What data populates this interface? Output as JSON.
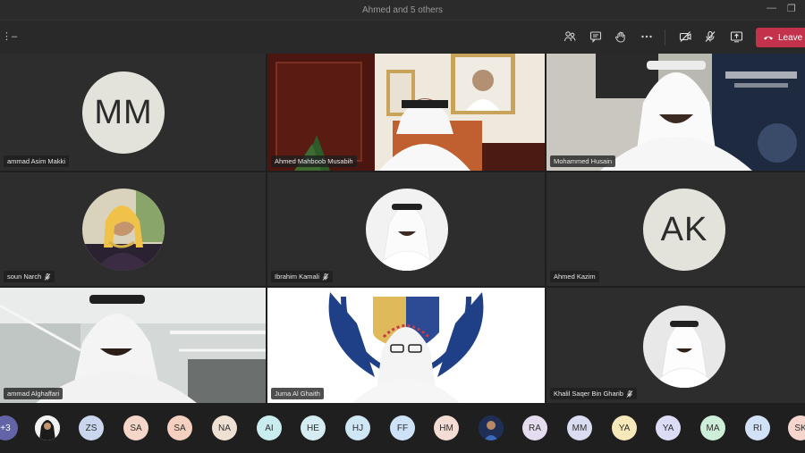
{
  "window": {
    "title": "Ahmed and 5 others",
    "minimize": "—",
    "restore": "❐"
  },
  "toolbar": {
    "more_left": "⋮–",
    "leave_label": "Leave"
  },
  "tiles": {
    "t1": {
      "name": "ammad Asim Makki",
      "initials": "MM"
    },
    "t2": {
      "name": "Ahmed Mahboob Musabih"
    },
    "t3": {
      "name": "Mohammed Husain"
    },
    "t4": {
      "name": "soun Narch"
    },
    "t5": {
      "name": "Ibrahim Kamali"
    },
    "t6": {
      "name": "Ahmed Kazim",
      "initials": "AK"
    },
    "t7": {
      "name": "ammad Alghaffari"
    },
    "t8": {
      "name": "Juma Al Ghaith"
    },
    "t9": {
      "name": "Khalil Saqer Bin Gharib"
    }
  },
  "participants": [
    "+3",
    "",
    "ZS",
    "SA",
    "SA",
    "NA",
    "AI",
    "HE",
    "HJ",
    "FF",
    "HM",
    "",
    "RA",
    "MM",
    "YA",
    "YA",
    "MA",
    "RI",
    "SK"
  ],
  "colors": {
    "leave": "#c4314b",
    "avatar_bg": "#e3e3db"
  }
}
